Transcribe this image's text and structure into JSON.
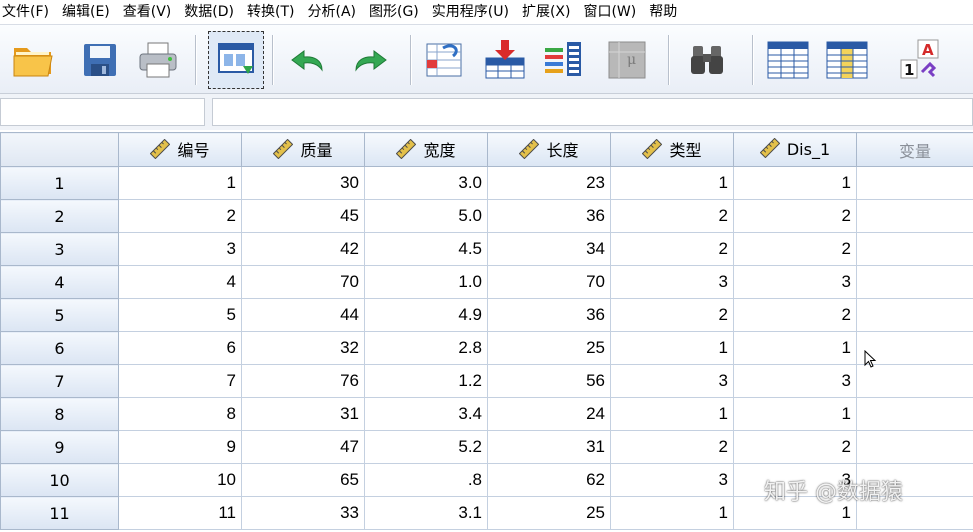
{
  "menu": [
    "文件(F)",
    "编辑(E)",
    "查看(V)",
    "数据(D)",
    "转换(T)",
    "分析(A)",
    "图形(G)",
    "实用程序(U)",
    "扩展(X)",
    "窗口(W)",
    "帮助"
  ],
  "toolbar": [
    {
      "icon": "open-folder-icon",
      "selected": false
    },
    {
      "icon": "save-icon",
      "selected": false
    },
    {
      "icon": "print-icon",
      "selected": false
    },
    {
      "icon": "dialog-recall-icon",
      "selected": true
    },
    {
      "icon": "undo-icon",
      "selected": false
    },
    {
      "icon": "redo-icon",
      "selected": false
    },
    {
      "icon": "go-to-case-icon",
      "selected": false
    },
    {
      "icon": "go-to-variable-icon",
      "selected": false
    },
    {
      "icon": "variables-icon",
      "selected": false
    },
    {
      "icon": "run-descriptives-icon",
      "selected": false,
      "disabled": true
    },
    {
      "icon": "find-icon",
      "selected": false
    },
    {
      "icon": "insert-cases-icon",
      "selected": false
    },
    {
      "icon": "insert-variable-icon",
      "selected": false
    },
    {
      "icon": "value-labels-icon",
      "selected": false
    }
  ],
  "cell_editor": {
    "reference": "",
    "value": ""
  },
  "grid": {
    "columns": [
      "编号",
      "质量",
      "宽度",
      "长度",
      "类型",
      "Dis_1"
    ],
    "empty_column_label": "变量",
    "rows": [
      {
        "n": "1",
        "cells": [
          "1",
          "30",
          "3.0",
          "23",
          "1",
          "1"
        ]
      },
      {
        "n": "2",
        "cells": [
          "2",
          "45",
          "5.0",
          "36",
          "2",
          "2"
        ]
      },
      {
        "n": "3",
        "cells": [
          "3",
          "42",
          "4.5",
          "34",
          "2",
          "2"
        ]
      },
      {
        "n": "4",
        "cells": [
          "4",
          "70",
          "1.0",
          "70",
          "3",
          "3"
        ]
      },
      {
        "n": "5",
        "cells": [
          "5",
          "44",
          "4.9",
          "36",
          "2",
          "2"
        ]
      },
      {
        "n": "6",
        "cells": [
          "6",
          "32",
          "2.8",
          "25",
          "1",
          "1"
        ]
      },
      {
        "n": "7",
        "cells": [
          "7",
          "76",
          "1.2",
          "56",
          "3",
          "3"
        ]
      },
      {
        "n": "8",
        "cells": [
          "8",
          "31",
          "3.4",
          "24",
          "1",
          "1"
        ]
      },
      {
        "n": "9",
        "cells": [
          "9",
          "47",
          "5.2",
          "31",
          "2",
          "2"
        ]
      },
      {
        "n": "10",
        "cells": [
          "10",
          "65",
          ".8",
          "62",
          "3",
          "3"
        ]
      },
      {
        "n": "11",
        "cells": [
          "11",
          "33",
          "3.1",
          "25",
          "1",
          "1"
        ]
      }
    ]
  },
  "watermark": "知乎 @数据猿",
  "colors": {
    "header_border": "#a9b8cc",
    "cell_border": "#c4d0e0",
    "ruler_yellow": "#e3c04a"
  }
}
